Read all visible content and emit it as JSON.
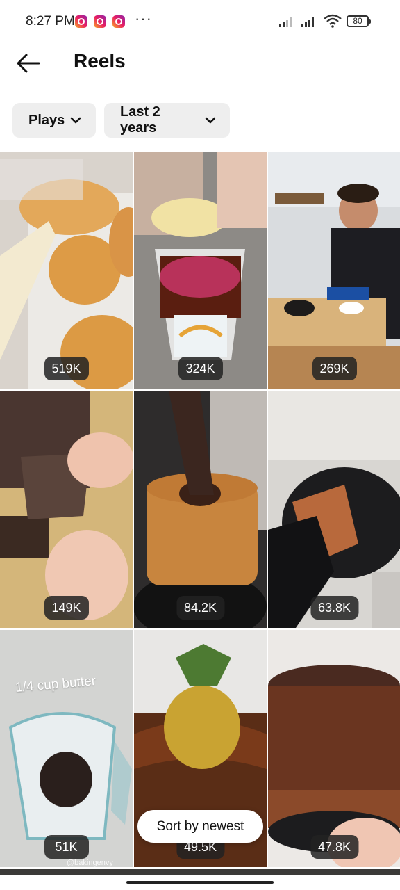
{
  "status_bar": {
    "time": "8:27 PM",
    "notification_icons": [
      "instagram-icon",
      "instagram-icon",
      "instagram-icon"
    ],
    "more": "···",
    "battery": "80"
  },
  "header": {
    "title": "Reels",
    "back_icon": "arrow-left-icon"
  },
  "filters": {
    "metric": "Plays",
    "range": "Last 2 years"
  },
  "reels": [
    {
      "plays": "519K",
      "subject": "cream-filled doughnuts"
    },
    {
      "plays": "324K",
      "subject": "rainbow sprinkles cup"
    },
    {
      "plays": "269K",
      "subject": "man with oreo rolls"
    },
    {
      "plays": "149K",
      "subject": "brownie pieces"
    },
    {
      "plays": "84.2K",
      "subject": "chocolate glazed chiffon cake"
    },
    {
      "plays": "63.8K",
      "subject": "chocolate bar in pot"
    },
    {
      "plays": "51K",
      "subject": "measuring cup with chocolate chips",
      "overlay_text": "1/4 cup butter",
      "watermark": "@bakingenvy"
    },
    {
      "plays": "49.5K",
      "subject": "gold strawberry on chocolate cake"
    },
    {
      "plays": "47.8K",
      "subject": "kit kat cake"
    }
  ],
  "sort_button": "Sort by newest",
  "colors": {
    "chip_bg": "#eeeeee",
    "count_badge": "#222222",
    "accent_instagram": "#e91e63"
  }
}
